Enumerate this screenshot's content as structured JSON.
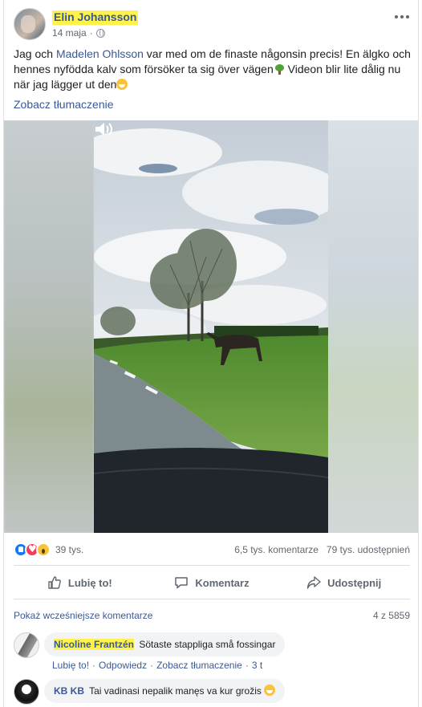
{
  "post": {
    "author": "Elin Johansson",
    "timestamp": "14 maja",
    "separator": "·",
    "text_before": "Jag och ",
    "mention": "Madelen Ohlsson",
    "text_mid": " var med om de finaste någonsin precis! En älgko och hennes nyfödda kalv som försöker ta sig över vägen",
    "text_after": " Videon blir lite dålig nu när jag lägger ut den",
    "translate_link": "Zobacz tłumaczenie"
  },
  "stats": {
    "reaction_count": "39 tys.",
    "comments": "6,5 tys. komentarze",
    "shares": "79 tys. udostępnień"
  },
  "actions": {
    "like": "Lubię to!",
    "comment": "Komentarz",
    "share": "Udostępnij"
  },
  "comments_section": {
    "previous_link": "Pokaż wcześniejsze komentarze",
    "count": "4 z 5859",
    "items": [
      {
        "name": "Nicoline Frantzén",
        "text": "Sötaste stappliga små fossingar",
        "like": "Lubię to!",
        "reply": "Odpowiedz",
        "translate": "Zobacz tłumaczenie",
        "time": "3 t",
        "dot": "·"
      },
      {
        "name": "KB KB",
        "text": "Tai vadinasi nepalik manęs va kur grožis"
      }
    ]
  },
  "icons": {
    "more": "more-options-icon",
    "globe": "globe-icon",
    "sound": "speaker-icon",
    "like": "thumbs-up-icon",
    "comment": "comment-bubble-icon",
    "share": "share-arrow-icon"
  },
  "colors": {
    "link": "#385898",
    "secondary_text": "#606770",
    "like_blue": "#1877f2",
    "love_red": "#f33e58",
    "wow_yellow": "#f7c33a",
    "name_highlight": "#fff24a"
  }
}
